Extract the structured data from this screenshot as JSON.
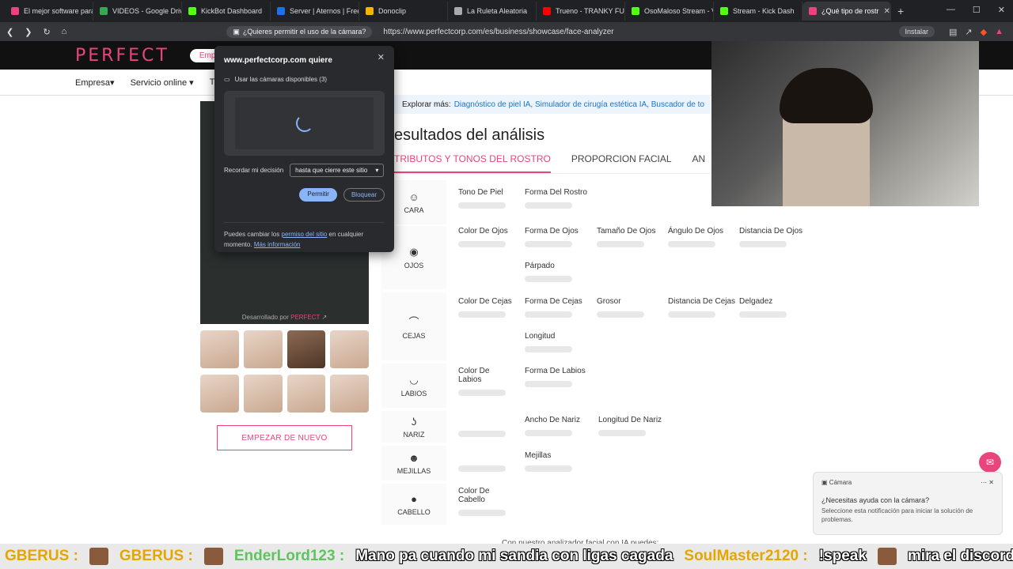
{
  "browser": {
    "tabs": [
      {
        "label": "El mejor software para",
        "color": "#e8457c"
      },
      {
        "label": "VIDEOS - Google Drive",
        "color": "#34a853"
      },
      {
        "label": "KickBot Dashboard",
        "color": "#53fc18"
      },
      {
        "label": "Server | Aternos | Free",
        "color": "#1a73e8"
      },
      {
        "label": "Donoclip",
        "color": "#f5b400"
      },
      {
        "label": "La Ruleta Aleatoria",
        "color": "#aaaaaa"
      },
      {
        "label": "Trueno - TRANKY FUN",
        "color": "#ff0000"
      },
      {
        "label": "OsoMaloso Stream - V",
        "color": "#53fc18"
      },
      {
        "label": "Stream - Kick Dash",
        "color": "#53fc18"
      },
      {
        "label": "¿Qué tipo de rostr",
        "color": "#e8457c"
      }
    ],
    "url": "https://www.perfectcorp.com/es/business/showcase/face-analyzer",
    "permission_chip": "¿Quieres permitir el uso de la cámara?",
    "install_label": "Instalar"
  },
  "site": {
    "logo": "PERFECT",
    "empresa_button": "Empresa",
    "header_partial": "R",
    "nav": [
      "Empresa",
      "Servicio online",
      "T"
    ],
    "explore_prefix": "Explorar más:",
    "explore_links": "Diagnóstico de piel IA, Simulador de cirugía estética IA, Buscador de to",
    "credit_text": "Desarrollado por",
    "credit_brand": "PERFECT",
    "restart_button": "EMPEZAR DE NUEVO",
    "results_title": "esultados del análisis",
    "tabs": [
      "TRIBUTOS Y TONOS DEL ROSTRO",
      "PROPORCION FACIAL",
      "AN"
    ],
    "categories": [
      {
        "label": "CARA",
        "icon": "face-icon"
      },
      {
        "label": "OJOS",
        "icon": "eye-icon"
      },
      {
        "label": "CEJAS",
        "icon": "eyebrow-icon"
      },
      {
        "label": "LABIOS",
        "icon": "lips-icon"
      },
      {
        "label": "NARIZ",
        "icon": "nose-icon"
      },
      {
        "label": "MEJILLAS",
        "icon": "cheeks-icon"
      },
      {
        "label": "CABELLO",
        "icon": "hair-icon"
      }
    ],
    "attributes": {
      "cara": [
        "Tono De Piel",
        "Forma Del Rostro"
      ],
      "ojos": [
        "Color De Ojos",
        "Forma De Ojos",
        "Tamaño De Ojos",
        "Ángulo De Ojos",
        "Distancia De Ojos",
        "Párpado"
      ],
      "cejas": [
        "Color De Cejas",
        "Forma De Cejas",
        "Grosor",
        "Distancia De Cejas",
        "Delgadez",
        "Longitud"
      ],
      "labios": [
        "Color De Labios",
        "Forma De Labios"
      ],
      "nariz": [
        "Ancho De Nariz",
        "Longitud De Nariz"
      ],
      "mejillas": [
        "Mejillas"
      ],
      "cabello": [
        "Color De Cabello"
      ]
    },
    "bottom_text": "Con nuestro analizador facial con IA puedes:"
  },
  "permission_dialog": {
    "title": "www.perfectcorp.com quiere",
    "camera_option": "Usar las cámaras disponibles (3)",
    "remember_label": "Recordar mi decisión",
    "remember_value": "hasta que cierre este sitio",
    "allow_button": "Permitir",
    "block_button": "Bloquear",
    "footer_prefix": "Puedes cambiar los",
    "footer_link": "permiso del sitio",
    "footer_middle": "en cualquier momento.",
    "footer_more": "Más información"
  },
  "camera_toast": {
    "title": "Cámara",
    "question": "¿Necesitas ayuda con la cámara?",
    "subtitle": "Seleccione esta notificación para iniciar la solución de problemas."
  },
  "ticker": {
    "user1": "GBERUS :",
    "user2": "GBERUS :",
    "user3": "EnderLord123 :",
    "message3": "Mano pa cuando mi sandia con ligas cagada",
    "user4": "SoulMaster2120 :",
    "message4": "!speak",
    "message5": "mira el discord"
  }
}
